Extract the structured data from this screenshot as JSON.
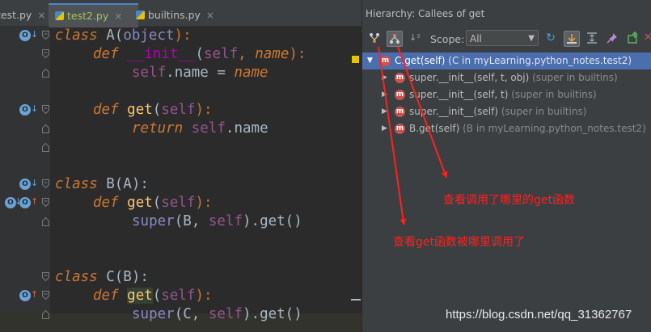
{
  "tabs": [
    {
      "label": "test.py",
      "close": "×"
    },
    {
      "label": "test2.py",
      "close": "×"
    },
    {
      "label": "builtins.py",
      "close": "×"
    }
  ],
  "code": {
    "l1": {
      "kw": "class",
      "name": " A",
      "paren": "(",
      "base": "object",
      "end": "):"
    },
    "l2": {
      "kw": "def",
      "name": "__init__",
      "open": "(",
      "self": "self",
      "comma": ", ",
      "param": "name",
      "end": "):"
    },
    "l3": {
      "self": "self",
      "rest": ".name = ",
      "val": "name"
    },
    "l4": {
      "kw": "def",
      "name": "get",
      "open": "(",
      "self": "self",
      "end": "):"
    },
    "l5": {
      "kw": "return",
      "self": "self",
      "rest": ".name"
    },
    "l6": {
      "kw": "class",
      "name": " B",
      "base": "(A):"
    },
    "l7": {
      "kw": "def",
      "name": "get",
      "open": "(",
      "self": "self",
      "end": "):"
    },
    "l8": {
      "sup": "super",
      "open": "(B, ",
      "self": "self",
      "rest": ").get()"
    },
    "l9": {
      "kw": "class",
      "name": " C",
      "base": "(B):"
    },
    "l10": {
      "kw": "def",
      "name": "get",
      "open": "(",
      "self": "self",
      "end": "):"
    },
    "l11": {
      "sup": "super",
      "open": "(C, ",
      "self": "self",
      "rest": ").get()"
    }
  },
  "panel": {
    "title": "Hierarchy: Callees of get",
    "scope_label": "Scope:",
    "scope_value": "All",
    "tree": [
      {
        "name": "C.get(self)",
        "loc": " (C in myLearning.python_notes.test2)"
      },
      {
        "name": "super.__init__(self, t, obj)",
        "loc": " (super in builtins)"
      },
      {
        "name": "super.__init__(self, t)",
        "loc": " (super in builtins)"
      },
      {
        "name": "super.__init__(self)",
        "loc": " (super in builtins)"
      },
      {
        "name": "B.get(self)",
        "loc": " (B in myLearning.python_notes.test2)"
      }
    ]
  },
  "annotations": {
    "callees": "查看调用了哪里的get函数",
    "callers": "查看get函数被哪里调用了"
  },
  "watermark": "https://blog.csdn.net/qq_31362767",
  "colors": {
    "accent_selection": "#4b6eaf",
    "annotation": "#ff2020",
    "keyword": "#cc7832",
    "function": "#ffc66d"
  }
}
